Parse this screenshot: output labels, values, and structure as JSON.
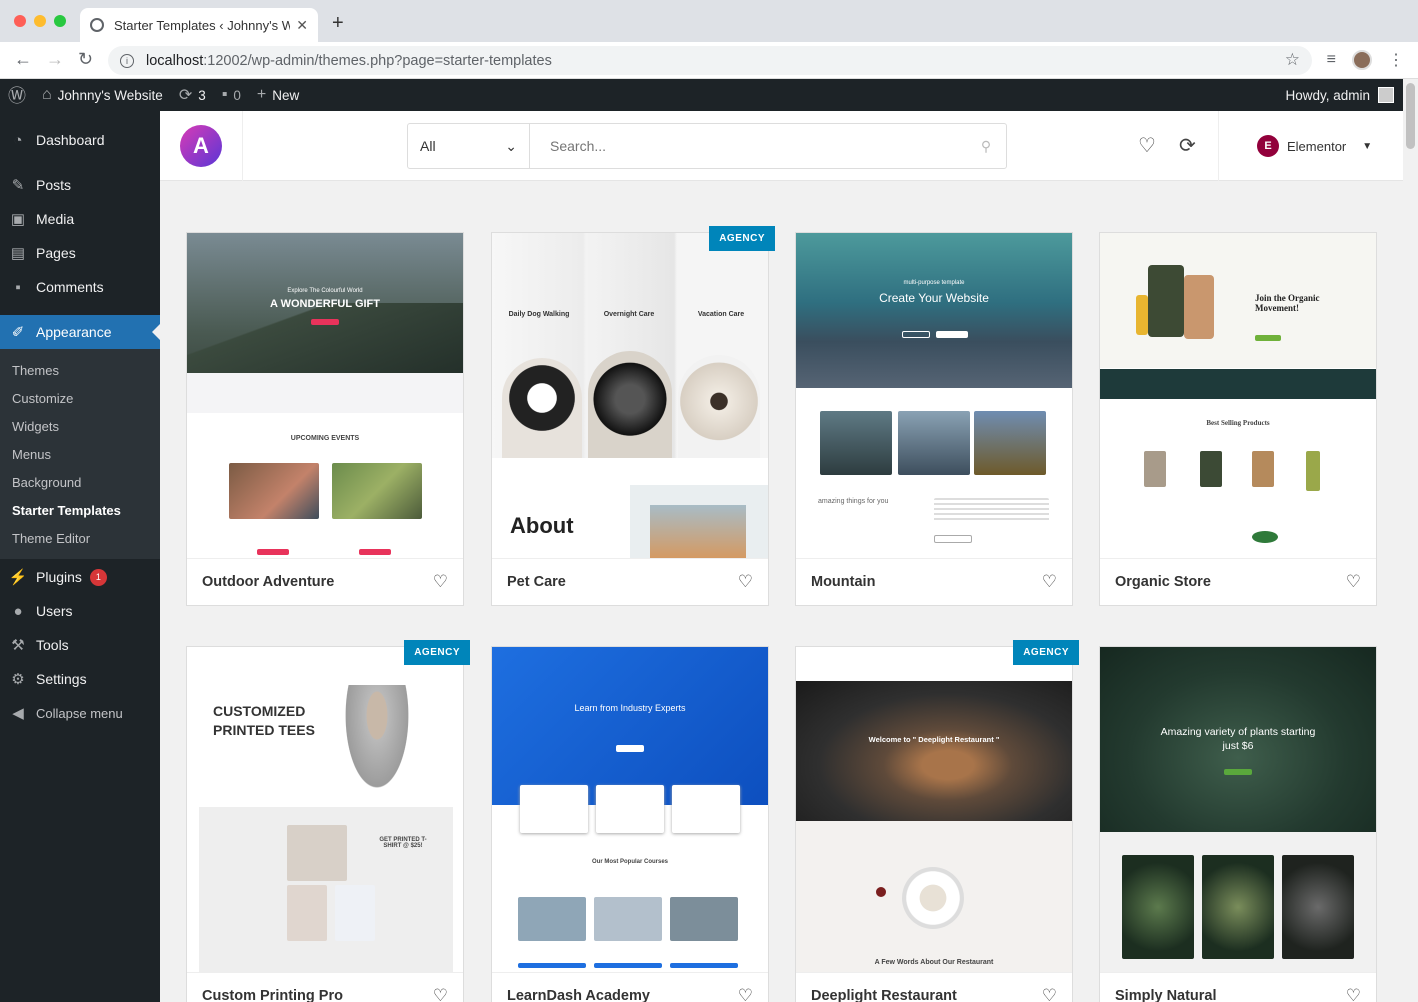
{
  "browser": {
    "tab_title": "Starter Templates ‹ Johnny's W",
    "url_host": "localhost",
    "url_path": ":12002/wp-admin/themes.php?page=starter-templates"
  },
  "adminbar": {
    "site_name": "Johnny's Website",
    "updates_count": "3",
    "comments_count": "0",
    "new_label": "New",
    "howdy": "Howdy, admin"
  },
  "sidebar": {
    "dashboard": "Dashboard",
    "posts": "Posts",
    "media": "Media",
    "pages": "Pages",
    "comments": "Comments",
    "appearance": "Appearance",
    "sub": [
      "Themes",
      "Customize",
      "Widgets",
      "Menus",
      "Background",
      "Starter Templates",
      "Theme Editor"
    ],
    "plugins": "Plugins",
    "plugins_badge": "1",
    "users": "Users",
    "tools": "Tools",
    "settings": "Settings",
    "collapse": "Collapse menu"
  },
  "header": {
    "filter_value": "All",
    "search_placeholder": "Search...",
    "builder_label": "Elementor"
  },
  "cards": [
    {
      "title": "Outdoor Adventure",
      "agency": "",
      "thumb_text": "A WONDERFUL GIFT",
      "thumb_sub": "Explore The Colourful World",
      "section_text": "UPCOMING EVENTS"
    },
    {
      "title": "Pet Care",
      "agency": "AGENCY",
      "thumb_text": "About",
      "col1": "Daily Dog Walking",
      "col2": "Overnight Care",
      "col3": "Vacation Care"
    },
    {
      "title": "Mountain",
      "agency": "",
      "thumb_text": "Create Your Website",
      "thumb_sub": "multi-purpose template",
      "section_text": "amazing things for you"
    },
    {
      "title": "Organic Store",
      "agency": "",
      "thumb_text": "Join the Organic Movement!",
      "section_text": "Best Selling Products"
    },
    {
      "title": "Custom Printing Pro",
      "agency": "AGENCY",
      "thumb_text": "CUSTOMIZED PRINTED TEES",
      "section_text": "GET PRINTED T-SHIRT @ $25!"
    },
    {
      "title": "LearnDash Academy",
      "agency": "",
      "thumb_text": "Learn from Industry Experts",
      "section_text": "Our Most Popular Courses"
    },
    {
      "title": "Deeplight Restaurant",
      "agency": "AGENCY",
      "thumb_text": "Welcome to \" Deeplight Restaurant \"",
      "section_text": "A Few Words About Our Restaurant"
    },
    {
      "title": "Simply Natural",
      "agency": "",
      "thumb_text": "Amazing variety of plants starting just $6",
      "section_text": ""
    }
  ]
}
